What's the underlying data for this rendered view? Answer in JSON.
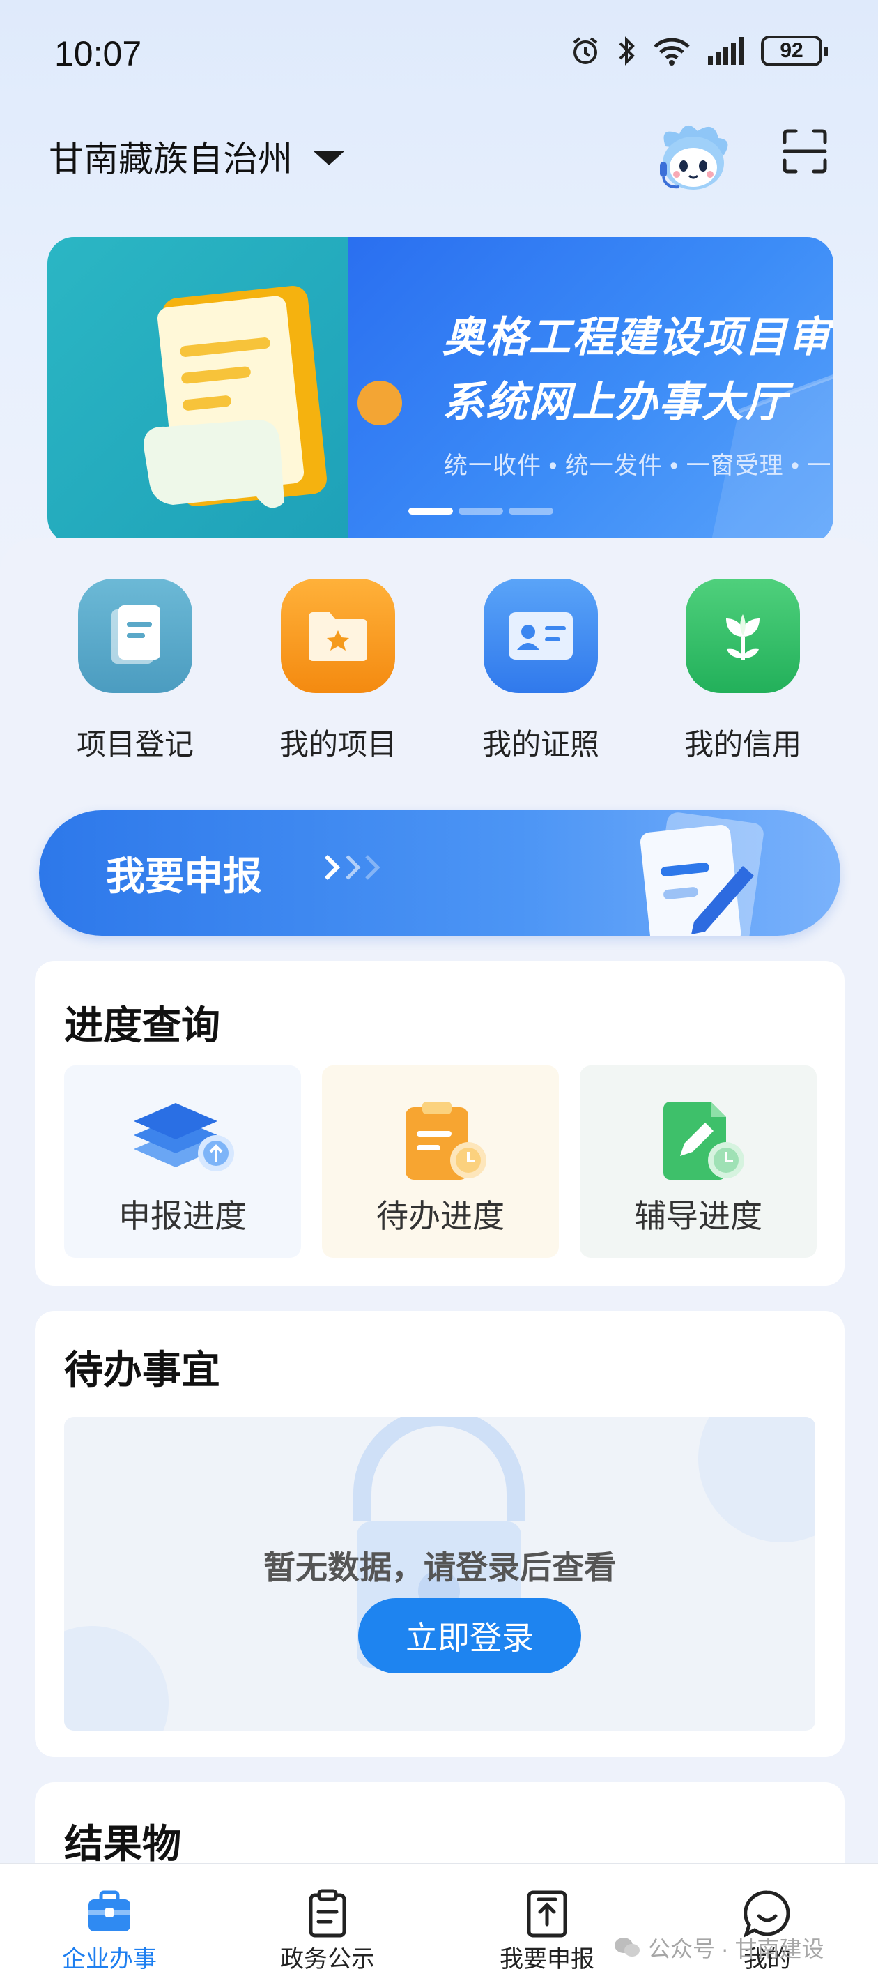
{
  "status_bar": {
    "time": "10:07",
    "battery": "92"
  },
  "header": {
    "location": "甘南藏族自治州"
  },
  "banner": {
    "title_line1": "奥格工程建设项目审批",
    "title_line2": "系统网上办事大厅",
    "subtitle": "统一收件 • 统一发件 • 一窗受理 • 一网通",
    "colors": {
      "left": "#22aec0",
      "right": "#2f78f2"
    }
  },
  "quick_actions": [
    {
      "label": "项目登记",
      "icon": "document-icon",
      "color": "#5aa8c8"
    },
    {
      "label": "我的项目",
      "icon": "folder-icon",
      "color": "#f59a1c"
    },
    {
      "label": "我的证照",
      "icon": "id-card-icon",
      "color": "#3b86f0"
    },
    {
      "label": "我的信用",
      "icon": "plant-icon",
      "color": "#2ec06a"
    }
  ],
  "report_banner": {
    "label": "我要申报"
  },
  "progress": {
    "title": "进度查询",
    "items": [
      {
        "label": "申报进度",
        "icon": "layers-upload-icon",
        "bg": "#f3f7fd"
      },
      {
        "label": "待办进度",
        "icon": "clipboard-clock-icon",
        "bg": "#fdf8ec"
      },
      {
        "label": "辅导进度",
        "icon": "file-edit-clock-icon",
        "bg": "#f2f6f4"
      }
    ]
  },
  "todo": {
    "title": "待办事宜",
    "empty_message": "暂无数据，请登录后查看",
    "login_label": "立即登录"
  },
  "results": {
    "title": "结果物"
  },
  "bottom_nav": [
    {
      "label": "企业办事",
      "icon": "briefcase-icon",
      "active": true
    },
    {
      "label": "政务公示",
      "icon": "clipboard-icon",
      "active": false
    },
    {
      "label": "我要申报",
      "icon": "upload-doc-icon",
      "active": false
    },
    {
      "label": "我的",
      "icon": "smile-chat-icon",
      "active": false
    }
  ],
  "watermark": {
    "text": "公众号 · 甘南建设"
  },
  "accent_color": "#1e84f0"
}
